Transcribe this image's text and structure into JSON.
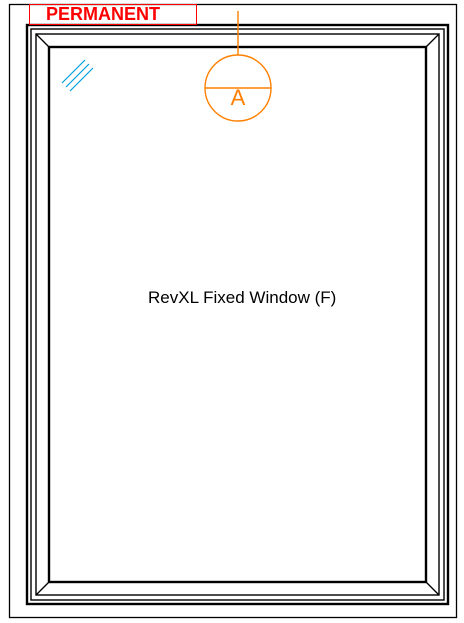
{
  "labels": {
    "stamp": "PERMANENT",
    "tag_letter": "A",
    "window_name": "RevXL Fixed Window (F)"
  },
  "colors": {
    "stamp": "#ff0000",
    "tag": "#ff8000",
    "glass_mark": "#00a0e0",
    "line": "#000000"
  }
}
